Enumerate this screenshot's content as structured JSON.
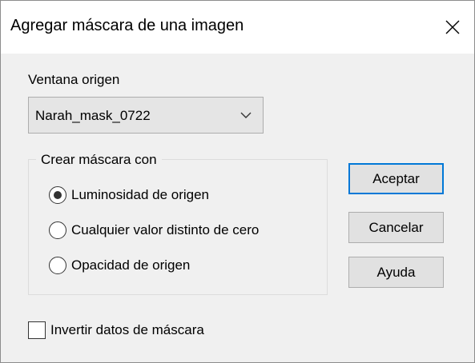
{
  "window": {
    "title": "Agregar máscara de una imagen",
    "close_icon": "close-icon"
  },
  "source": {
    "label": "Ventana origen",
    "selected": "Narah_mask_0722",
    "dropdown_icon": "chevron-down-icon"
  },
  "mask_group": {
    "legend": "Crear máscara con",
    "options": [
      {
        "label": "Luminosidad de origen",
        "checked": true
      },
      {
        "label": "Cualquier valor distinto de cero",
        "checked": false
      },
      {
        "label": "Opacidad de origen",
        "checked": false
      }
    ]
  },
  "buttons": {
    "ok": "Aceptar",
    "cancel": "Cancelar",
    "help": "Ayuda"
  },
  "invert": {
    "label": "Invertir datos de máscara",
    "checked": false
  }
}
